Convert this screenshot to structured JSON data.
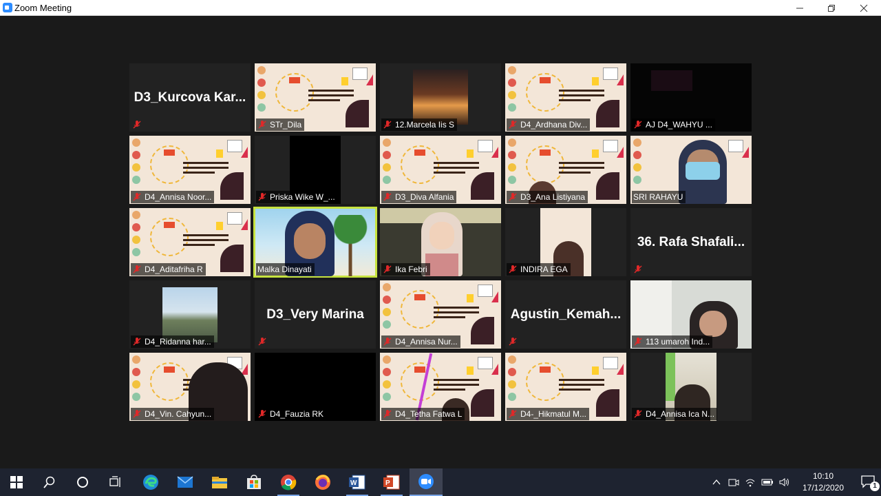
{
  "window": {
    "title": "Zoom Meeting"
  },
  "tiles": [
    {
      "id": "t0",
      "name": "D3_Kurcova Kar...",
      "big": "D3_Kurcova  Kar...",
      "label": "",
      "kind": "name"
    },
    {
      "id": "t1",
      "name": "STr_Dila",
      "label": "STr_Dila",
      "kind": "slide"
    },
    {
      "id": "t2",
      "name": "12.Marcela Iis S",
      "label": "12.Marcela Iis S",
      "kind": "photo"
    },
    {
      "id": "t3",
      "name": "D4_Ardhana Div...",
      "label": "D4_Ardhana Div...",
      "kind": "slide"
    },
    {
      "id": "t4",
      "name": "AJ D4_WAHYU ...",
      "label": "AJ D4_WAHYU ...",
      "kind": "dark"
    },
    {
      "id": "t5",
      "name": "D4_Annisa Noor...",
      "label": "D4_Annisa Noor...",
      "kind": "slide"
    },
    {
      "id": "t6",
      "name": "Priska Wike W_...",
      "label": "Priska Wike W_...",
      "kind": "black"
    },
    {
      "id": "t7",
      "name": "D3_Diva Alfania",
      "label": "D3_Diva Alfania",
      "kind": "slide"
    },
    {
      "id": "t8",
      "name": "D3_Ana Listiyana",
      "label": "D3_Ana Listiyana",
      "kind": "slide"
    },
    {
      "id": "t9",
      "name": "SRI RAHAYU",
      "label": "SRI RAHAYU",
      "kind": "video"
    },
    {
      "id": "t10",
      "name": "D4_Aditafriha R",
      "label": "D4_Aditafriha R",
      "kind": "slide"
    },
    {
      "id": "t11",
      "name": "Malka Dinayati",
      "label": "Malka Dinayati",
      "kind": "beach"
    },
    {
      "id": "t12",
      "name": "Ika Febri",
      "label": "Ika Febri",
      "kind": "video"
    },
    {
      "id": "t13",
      "name": "INDIRA EGA",
      "label": "INDIRA EGA",
      "kind": "slide-small"
    },
    {
      "id": "t14",
      "name": "36. Rafa Shafali...",
      "big": "36. Rafa Shafali...",
      "label": "",
      "kind": "name"
    },
    {
      "id": "t15",
      "name": "D4_Ridanna har...",
      "label": "D4_Ridanna har...",
      "kind": "photo-small"
    },
    {
      "id": "t16",
      "name": "D3_Very Marina",
      "big": "D3_Very Marina",
      "label": "",
      "kind": "name"
    },
    {
      "id": "t17",
      "name": "D4_Annisa Nur...",
      "label": "D4_Annisa Nur...",
      "kind": "slide"
    },
    {
      "id": "t18",
      "name": "Agustin_Kemah...",
      "big": "Agustin_Kemah...",
      "label": "",
      "kind": "name"
    },
    {
      "id": "t19",
      "name": "113 umaroh Ind...",
      "label": "113 umaroh Ind...",
      "kind": "video"
    },
    {
      "id": "t20",
      "name": "D4_Vin. Cahyun...",
      "label": "D4_Vin. Cahyun...",
      "kind": "slide"
    },
    {
      "id": "t21",
      "name": "D4_Fauzia RK",
      "label": "D4_Fauzia RK",
      "kind": "black"
    },
    {
      "id": "t22",
      "name": "D4_Tetha Fatwa L",
      "label": "D4_Tetha Fatwa L",
      "kind": "slide"
    },
    {
      "id": "t23",
      "name": "D4-_Hikmatul M...",
      "label": "D4-_Hikmatul M...",
      "kind": "slide"
    },
    {
      "id": "t24",
      "name": "D4_Annisa Ica N...",
      "label": "D4_Annisa Ica N...",
      "kind": "photo-small"
    }
  ],
  "taskbar": {
    "time": "10:10",
    "date": "17/12/2020",
    "notification_count": "1"
  }
}
